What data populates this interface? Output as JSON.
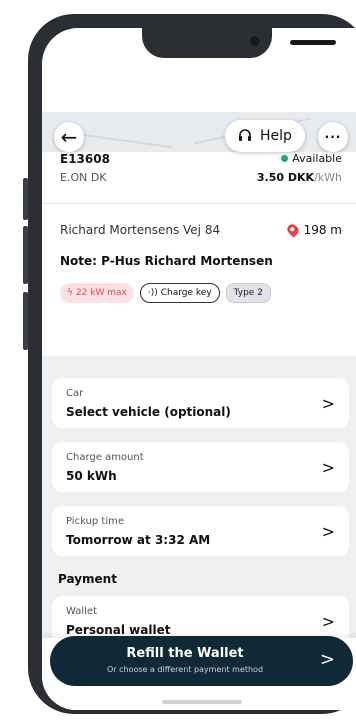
{
  "header": {
    "help_label": "Help",
    "more_label": "···"
  },
  "station": {
    "id": "E13608",
    "operator": "E.ON DK",
    "status": "Available",
    "price_value": "3.50 DKK",
    "price_unit": "/kWh",
    "status_color": "#1aa37a"
  },
  "location": {
    "address": "Richard Mortensens Vej 84",
    "distance": "198 m",
    "note": "Note: P-Hus Richard Mortensen"
  },
  "tags": {
    "power": "22 kW max",
    "charge_key": "Charge key",
    "connector": "Type 2"
  },
  "fields": [
    {
      "label": "Car",
      "value": "Select vehicle (optional)"
    },
    {
      "label": "Charge amount",
      "value": "50 kWh"
    },
    {
      "label": "Pickup time",
      "value": "Tomorrow at 3:32 AM"
    }
  ],
  "payment": {
    "heading": "Payment",
    "label": "Wallet",
    "value": "Personal wallet"
  },
  "cta": {
    "title": "Refill the Wallet",
    "subtitle": "Or choose a different payment method",
    "color": "#0f2a36"
  }
}
